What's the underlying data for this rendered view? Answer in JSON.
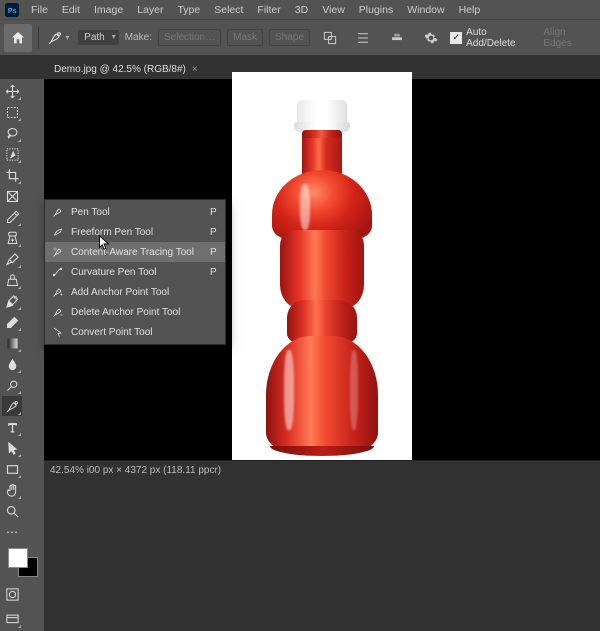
{
  "menu": {
    "items": [
      "File",
      "Edit",
      "Image",
      "Layer",
      "Type",
      "Select",
      "Filter",
      "3D",
      "View",
      "Plugins",
      "Window",
      "Help"
    ]
  },
  "options": {
    "mode_label": "Path",
    "make_label": "Make:",
    "selection_btn": "Selection…",
    "mask_btn": "Mask",
    "shape_btn": "Shape",
    "auto_label": "Auto Add/Delete",
    "auto_checked": "✓",
    "align_label": "Align Edges"
  },
  "tab": {
    "title": "Demo.jpg @ 42.5% (RGB/8#)",
    "close": "×"
  },
  "flyout": {
    "items": [
      {
        "label": "Pen Tool",
        "shortcut": "P"
      },
      {
        "label": "Freeform Pen Tool",
        "shortcut": "P"
      },
      {
        "label": "Content-Aware Tracing Tool",
        "shortcut": "P"
      },
      {
        "label": "Curvature Pen Tool",
        "shortcut": "P"
      },
      {
        "label": "Add Anchor Point Tool",
        "shortcut": ""
      },
      {
        "label": "Delete Anchor Point Tool",
        "shortcut": ""
      },
      {
        "label": "Convert Point Tool",
        "shortcut": ""
      }
    ],
    "selected_index": 2
  },
  "status": {
    "text": "42.54% i00 px × 4372 px (118.11 ppcr)"
  }
}
